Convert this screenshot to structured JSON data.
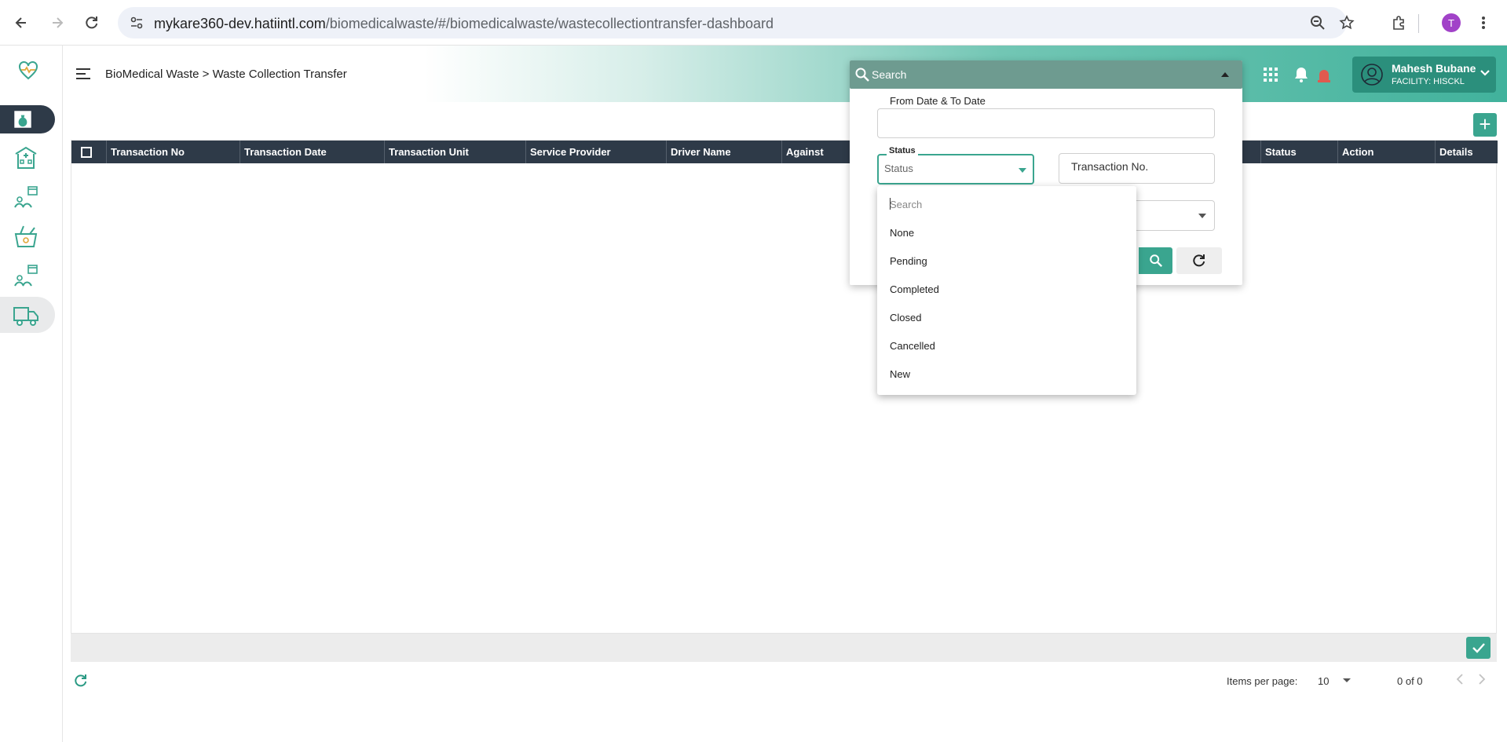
{
  "browser": {
    "url_host": "mykare360-dev.hatiintl.com",
    "url_path": "/biomedicalwaste/#/biomedicalwaste/wastecollectiontransfer-dashboard",
    "profile_initial": "T"
  },
  "header": {
    "breadcrumb": "BioMedical Waste > Waste Collection Transfer",
    "user_name": "Mahesh Bubane",
    "facility": "FACILITY: HISCKL"
  },
  "table": {
    "columns": [
      "Transaction No",
      "Transaction Date",
      "Transaction Unit",
      "Service Provider",
      "Driver Name",
      "Against",
      "Status",
      "Action",
      "Details"
    ]
  },
  "search_panel": {
    "placeholder": "Search",
    "date_label": "From Date & To Date",
    "status_label": "Status",
    "status_placeholder": "Status",
    "txn_placeholder": "Transaction No."
  },
  "status_dropdown": {
    "search_placeholder": "Search",
    "options": [
      "None",
      "Pending",
      "Completed",
      "Closed",
      "Cancelled",
      "New"
    ]
  },
  "pagination": {
    "items_per_page_label": "Items per page:",
    "page_size": "10",
    "range": "0 of 0"
  },
  "colors": {
    "accent": "#3aa58f",
    "dark_header": "#2e3a48"
  }
}
